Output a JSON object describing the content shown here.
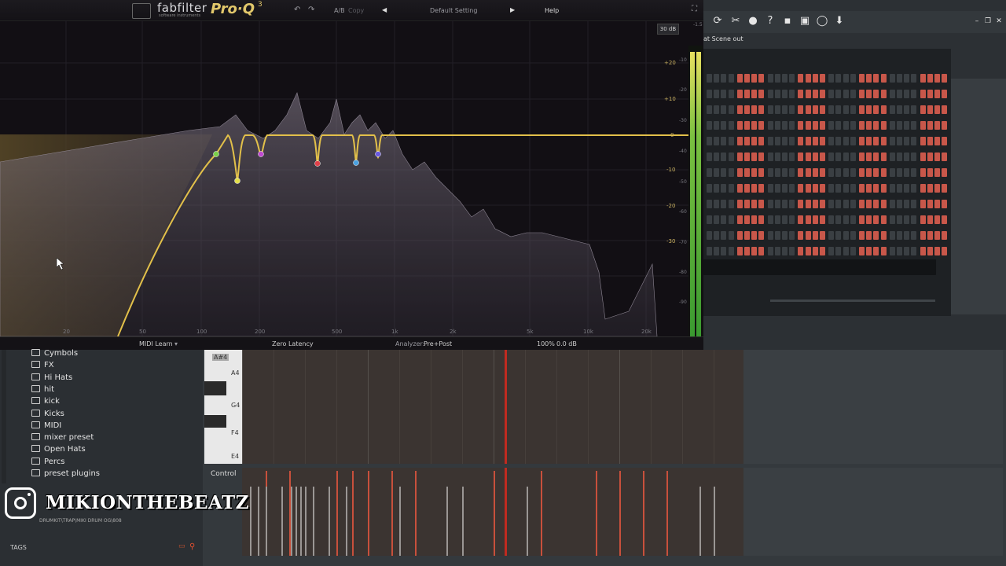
{
  "eq": {
    "brand": "fabfilter",
    "brand_sub": "software instruments",
    "product": "Pro·Q",
    "product_ver": "3",
    "ab": "A/B",
    "copy": "Copy",
    "preset": "Default Setting",
    "help": "Help",
    "range": "30 dB",
    "db_left": [
      "+20",
      "+10",
      "0",
      "-10",
      "-20",
      "-30"
    ],
    "db_right": [
      "-10",
      "-20",
      "-30",
      "-40",
      "-50",
      "-60",
      "-70",
      "-80",
      "-90"
    ],
    "hz": [
      "20",
      "50",
      "100",
      "200",
      "500",
      "1k",
      "2k",
      "5k",
      "10k",
      "20k"
    ],
    "midi_learn": "MIDI Learn",
    "latency": "Zero Latency",
    "analyzer_label": "Analyzer:",
    "analyzer_value": "Pre+Post",
    "zoom": "100%",
    "gain": "0.0 dB",
    "meter_top": "-1.5",
    "band_colors": [
      "#7bd04a",
      "#e4e04a",
      "#c04ad0",
      "#e0404a",
      "#4aa0e0",
      "#6a5ae0"
    ],
    "accent": "#e2c04a"
  },
  "channel_rack": {
    "scene_label": "at Scene out",
    "pattern_color": "#c8574a",
    "rows": 12
  },
  "browser": {
    "folders": [
      "Cymbols",
      "FX",
      "Hi Hats",
      "hit",
      "kick",
      "Kicks",
      "MIDI",
      "mixer preset",
      "Open Hats",
      "Percs",
      "preset plugins"
    ],
    "path": "DRUMKIT\\TRAP\\MIKI DRUM OG\\808",
    "tags": "TAGS"
  },
  "piano_roll": {
    "keys": [
      "A#4",
      "A4",
      "G4",
      "F4",
      "E4"
    ],
    "control_label": "Control"
  },
  "watermark": {
    "handle": "MIKIONTHEBEATZ"
  }
}
